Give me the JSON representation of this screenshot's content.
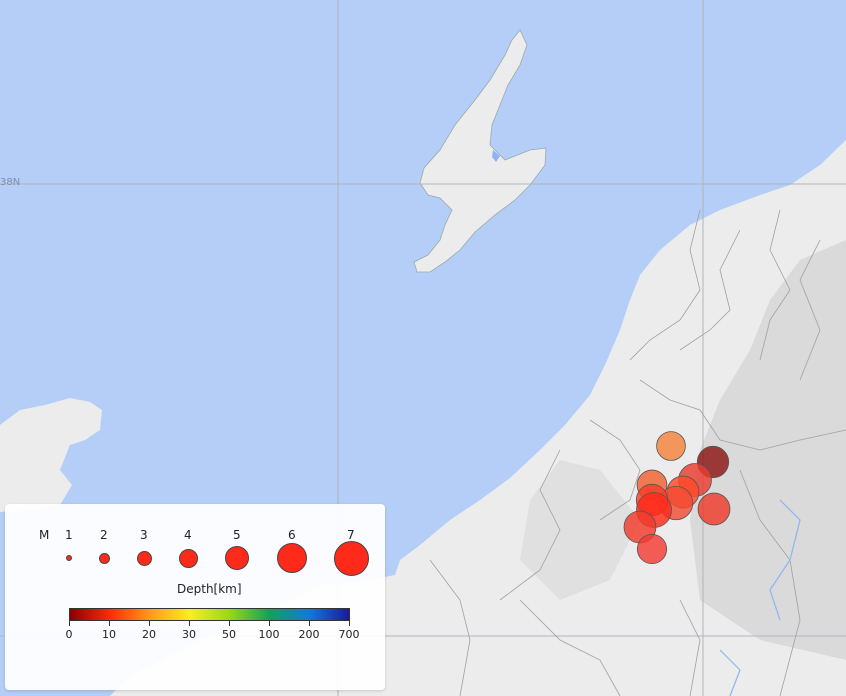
{
  "map": {
    "colors": {
      "sea": "#b4cef8",
      "land": "#ececec",
      "mountain": "#d4d4d4",
      "border": "#9a9a9a",
      "grid": "#b8b8c0",
      "river": "#8fb4f4"
    },
    "grid_label": "38N"
  },
  "events": [
    {
      "depth_color": "#f4823c",
      "magnitude": 4.0
    },
    {
      "depth_color": "#8b1414",
      "magnitude": 4.5
    },
    {
      "depth_color": "#f26030",
      "magnitude": 4.2
    },
    {
      "depth_color": "#ea3a2e",
      "magnitude": 4.8
    },
    {
      "depth_color": "#ff4a2a",
      "magnitude": 4.6
    },
    {
      "depth_color": "#f24a33",
      "magnitude": 4.9
    },
    {
      "depth_color": "#ff3a26",
      "magnitude": 4.5
    },
    {
      "depth_color": "#ee3a2a",
      "magnitude": 4.6
    },
    {
      "depth_color": "#ff2a1a",
      "magnitude": 5.2
    },
    {
      "depth_color": "#f23a2a",
      "magnitude": 4.6
    },
    {
      "depth_color": "#f43a33",
      "magnitude": 4.1
    }
  ],
  "legend": {
    "magnitude_label": "M",
    "magnitudes": [
      "1",
      "2",
      "3",
      "4",
      "5",
      "6",
      "7"
    ],
    "depth_title": "Depth[km]",
    "depth_ticks": [
      "0",
      "10",
      "20",
      "30",
      "50",
      "100",
      "200",
      "700"
    ],
    "depth_colors": [
      "#8b0000",
      "#ff2a0a",
      "#ff9a1a",
      "#f6f01a",
      "#9ad81a",
      "#14a05a",
      "#1478d8",
      "#1a1a9a"
    ],
    "circle_fill": "#ff2a1a"
  }
}
